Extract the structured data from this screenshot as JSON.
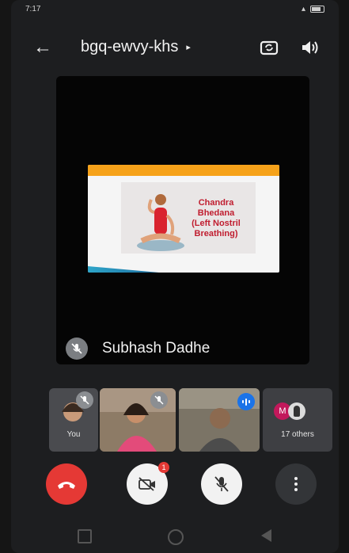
{
  "status_bar": {
    "time": "7:17"
  },
  "header": {
    "meeting_code": "bgq-ewvy-khs",
    "caret": "▸"
  },
  "main_tile": {
    "slide": {
      "text_lines": [
        "Chandra",
        "Bhedana",
        "(Left Nostril",
        "Breathing)"
      ]
    },
    "speaker_name": "Subhash Dadhe"
  },
  "thumbnails": {
    "you_label": "You",
    "others_label": "17 others",
    "others_avatar_letter": "M"
  },
  "controls": {
    "video_badge_count": "1"
  },
  "colors": {
    "end_call": "#e53935",
    "speaking_indicator": "#1a73e8",
    "avatar_m": "#c2185b"
  },
  "icons": {
    "back": "arrow-left",
    "camera_switch": "camera-switch",
    "speaker": "volume-up",
    "end_call": "phone-hangup",
    "video_off": "video-off",
    "mic_off": "mic-off",
    "more": "more-vertical"
  }
}
